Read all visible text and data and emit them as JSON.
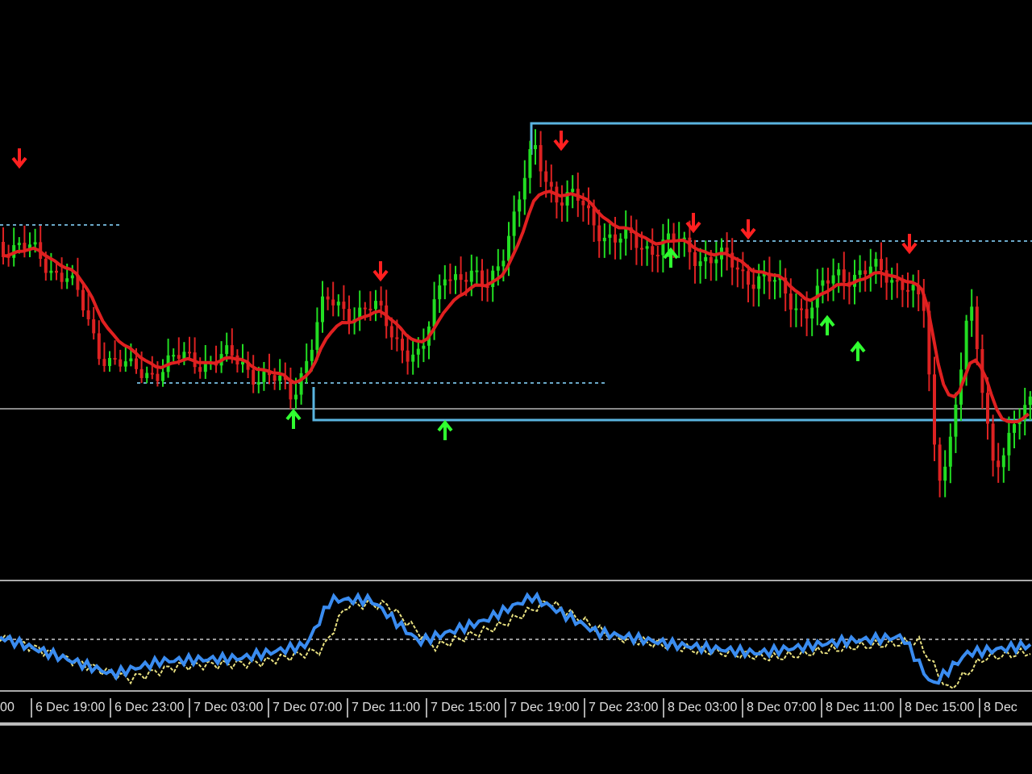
{
  "time_axis": {
    "labels": [
      "00",
      "6 Dec 19:00",
      "6 Dec 23:00",
      "7 Dec 03:00",
      "7 Dec 07:00",
      "7 Dec 11:00",
      "7 Dec 15:00",
      "7 Dec 19:00",
      "7 Dec 23:00",
      "8 Dec 03:00",
      "8 Dec 07:00",
      "8 Dec 11:00",
      "8 Dec 15:00",
      "8 Dec"
    ]
  }
}
